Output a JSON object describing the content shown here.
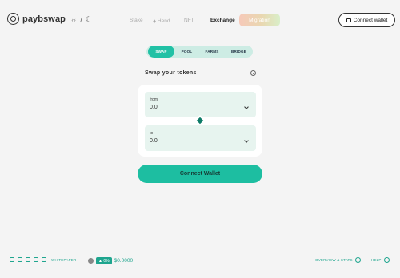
{
  "app": {
    "logo_text": "paybswap"
  },
  "header": {
    "theme_sun": "☼",
    "theme_sep": "/",
    "theme_moon": "☾",
    "nav": [
      {
        "label": "Stake"
      },
      {
        "label": "Hend"
      },
      {
        "label": "NFT"
      },
      {
        "label": "Exchange"
      },
      {
        "label": "Migration"
      }
    ],
    "connect_label": "Connect wallet"
  },
  "tabs": [
    {
      "label": "SWAP",
      "active": true
    },
    {
      "label": "POOL",
      "active": false
    },
    {
      "label": "FARMS",
      "active": false
    },
    {
      "label": "BRIDGE",
      "active": false
    }
  ],
  "swap": {
    "title": "Swap your tokens",
    "from_label": "from",
    "from_value": "0.0",
    "to_label": "to",
    "to_value": "0.0",
    "connect_label": "Connect Wallet"
  },
  "footer": {
    "whitepaper_label": "WHITEPAPER",
    "token_change": "▲ 0%",
    "token_price": "$0.0000",
    "overview_label": "OVERVIEW & STATS",
    "help_label": "HELP"
  },
  "colors": {
    "accent": "#1dbea1",
    "background": "#f4f4f4",
    "field_bg": "#e7f4ef",
    "tabs_bg": "#cdece4"
  }
}
